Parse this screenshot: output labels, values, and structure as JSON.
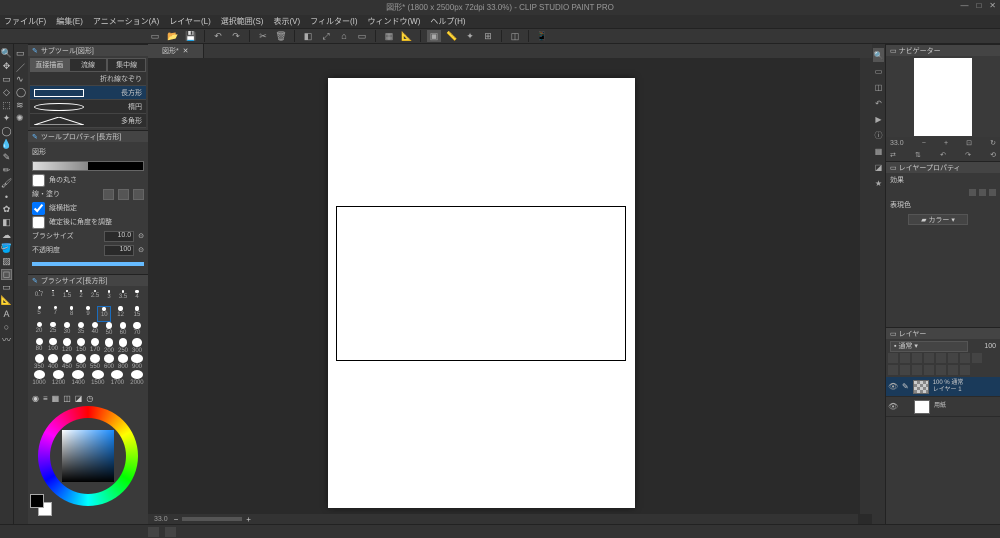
{
  "title": "図形* (1800 x 2500px 72dpi 33.0%) - CLIP STUDIO PAINT PRO",
  "menu": [
    "ファイル(F)",
    "編集(E)",
    "アニメーション(A)",
    "レイヤー(L)",
    "選択範囲(S)",
    "表示(V)",
    "フィルター(I)",
    "ウィンドウ(W)",
    "ヘルプ(H)"
  ],
  "subtool": {
    "header": "サブツール[図形]",
    "tabs": [
      "直接描画",
      "流線",
      "集中線"
    ],
    "list_header": "折れ線なぞり",
    "shapes": [
      "長方形",
      "楕円",
      "多角形"
    ]
  },
  "toolprop": {
    "header": "ツールプロパティ[長方形]",
    "fill_label": "図形",
    "round_label": "角の丸さ",
    "line_label": "線・塗り",
    "aspect_label": "縦横指定",
    "rotate_label": "確定後に角度を調整",
    "brush_size_label": "ブラシサイズ",
    "brush_size_val": "10.0",
    "opacity_label": "不透明度",
    "opacity_val": "100"
  },
  "brushsize": {
    "header": "ブラシサイズ[長方形]",
    "row1": [
      "0.7",
      "1",
      "1.5",
      "2",
      "2.5",
      "3",
      "3.5",
      "4"
    ],
    "row2": [
      "5",
      "7",
      "8",
      "9",
      "10",
      "12",
      "15"
    ],
    "row3": [
      "20",
      "25",
      "30",
      "35",
      "40",
      "50",
      "60",
      "70"
    ],
    "row4": [
      "80",
      "100",
      "120",
      "150",
      "170",
      "200",
      "250",
      "300"
    ],
    "row5": [
      "350",
      "400",
      "450",
      "500",
      "550",
      "600",
      "800",
      "900"
    ],
    "row6": [
      "1000",
      "1200",
      "1400",
      "1500",
      "1700",
      "2000"
    ]
  },
  "canvas_tab": "図形*",
  "zoom": "33.0",
  "navigator": {
    "header": "ナビゲーター",
    "zoom_val": "33.0"
  },
  "layerprop": {
    "header": "レイヤープロパティ",
    "effect": "効果",
    "expr": "表現色",
    "mode": "カラー"
  },
  "layers": {
    "header": "レイヤー",
    "mode": "通常",
    "opacity": "100",
    "items": [
      {
        "name": "レイヤー 1",
        "meta": "100 % 通常"
      },
      {
        "name": "用紙",
        "meta": ""
      }
    ]
  }
}
